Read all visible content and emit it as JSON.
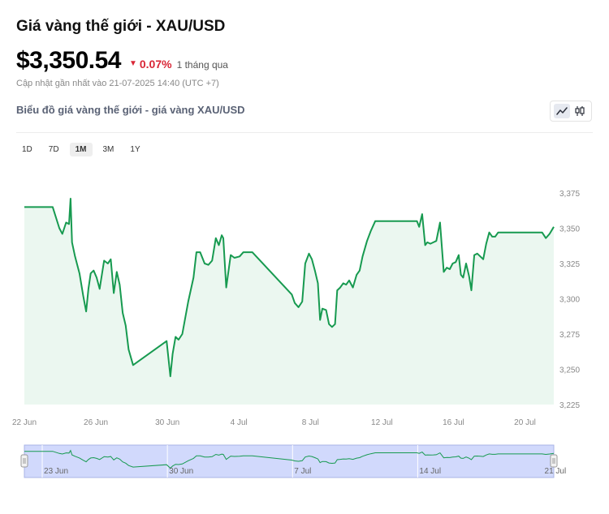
{
  "header": {
    "title": "Giá vàng thế giới - XAU/USD",
    "price": "$3,350.54",
    "change_arrow": "▼",
    "change_pct": "0.07%",
    "change_period": "1 tháng qua",
    "updated": "Cập nhật gần nhất vào 21-07-2025 14:40 (UTC +7)"
  },
  "chart_section": {
    "title": "Biểu đồ giá vàng thế giới - giá vàng XAU/USD"
  },
  "ranges": [
    "1D",
    "7D",
    "1M",
    "3M",
    "1Y"
  ],
  "active_range": "1M",
  "colors": {
    "line": "#179a50",
    "area": "#ebf7f0",
    "change": "#d92636",
    "navigator_fill": "#c9d2fb"
  },
  "icons": {
    "line_mode": "line-chart-icon",
    "candle_mode": "candlestick-icon"
  },
  "chart_data": {
    "type": "area",
    "title": "",
    "xlabel": "",
    "ylabel": "",
    "ylim": [
      3225,
      3375
    ],
    "y_ticks": [
      3225,
      3250,
      3275,
      3300,
      3325,
      3350,
      3375
    ],
    "y_tick_labels": [
      "3,225",
      "3,250",
      "3,275",
      "3,300",
      "3,325",
      "3,350",
      "3,375"
    ],
    "x_range": [
      "2025-06-22",
      "2025-07-21"
    ],
    "x_ticks": [
      {
        "date": "2025-06-22",
        "label": "22 Jun"
      },
      {
        "date": "2025-06-26",
        "label": "26 Jun"
      },
      {
        "date": "2025-06-30",
        "label": "30 Jun"
      },
      {
        "date": "2025-07-04",
        "label": "4 Jul"
      },
      {
        "date": "2025-07-08",
        "label": "8 Jul"
      },
      {
        "date": "2025-07-12",
        "label": "12 Jul"
      },
      {
        "date": "2025-07-16",
        "label": "16 Jul"
      },
      {
        "date": "2025-07-20",
        "label": "20 Jul"
      }
    ],
    "navigator_ticks": [
      {
        "date": "2025-06-23",
        "label": "23 Jun"
      },
      {
        "date": "2025-06-30",
        "label": "30 Jun"
      },
      {
        "date": "2025-07-07",
        "label": "7 Jul"
      },
      {
        "date": "2025-07-14",
        "label": "14 Jul"
      },
      {
        "date": "2025-07-21",
        "label": "21 Jul"
      }
    ],
    "series": [
      {
        "x": [
          "2025-06-22 00:00",
          "2025-06-23 14:00",
          "2025-06-23 23:00",
          "2025-06-24 03:00",
          "2025-06-24 08:00",
          "2025-06-24 12:00",
          "2025-06-24 14:00",
          "2025-06-24 16:00",
          "2025-06-24 20:00",
          "2025-06-25 02:00",
          "2025-06-25 07:00",
          "2025-06-25 11:00",
          "2025-06-25 14:00",
          "2025-06-25 17:00",
          "2025-06-25 21:00",
          "2025-06-26 01:00",
          "2025-06-26 05:00",
          "2025-06-26 11:00",
          "2025-06-26 16:00",
          "2025-06-26 20:00",
          "2025-06-27 00:00",
          "2025-06-27 04:00",
          "2025-06-27 08:00",
          "2025-06-27 12:00",
          "2025-06-27 16:00",
          "2025-06-27 20:00",
          "2025-06-28 02:00",
          "2025-06-29 23:00",
          "2025-06-30 04:00",
          "2025-06-30 07:00",
          "2025-06-30 11:00",
          "2025-06-30 15:00",
          "2025-06-30 20:00",
          "2025-07-01 04:00",
          "2025-07-01 11:00",
          "2025-07-01 15:00",
          "2025-07-01 20:00",
          "2025-07-02 02:00",
          "2025-07-02 07:00",
          "2025-07-02 12:00",
          "2025-07-02 17:00",
          "2025-07-02 21:00",
          "2025-07-03 01:00",
          "2025-07-03 03:00",
          "2025-07-03 07:00",
          "2025-07-03 13:00",
          "2025-07-03 18:00",
          "2025-07-04 01:00",
          "2025-07-04 06:00",
          "2025-07-04 13:00",
          "2025-07-04 18:00",
          "2025-07-06 23:00",
          "2025-07-07 03:00",
          "2025-07-07 08:00",
          "2025-07-07 13:00",
          "2025-07-07 17:00",
          "2025-07-07 22:00",
          "2025-07-08 02:00",
          "2025-07-08 06:00",
          "2025-07-08 10:00",
          "2025-07-08 13:00",
          "2025-07-08 16:00",
          "2025-07-08 21:00",
          "2025-07-09 01:00",
          "2025-07-09 05:00",
          "2025-07-09 09:00",
          "2025-07-09 12:00",
          "2025-07-09 16:00",
          "2025-07-09 20:00",
          "2025-07-10 00:00",
          "2025-07-10 04:00",
          "2025-07-10 09:00",
          "2025-07-10 14:00",
          "2025-07-10 18:00",
          "2025-07-10 22:00",
          "2025-07-11 04:00",
          "2025-07-11 09:00",
          "2025-07-11 15:00",
          "2025-07-11 21:00",
          "2025-07-13 23:00",
          "2025-07-14 02:00",
          "2025-07-14 06:00",
          "2025-07-14 10:00",
          "2025-07-14 13:00",
          "2025-07-14 17:00",
          "2025-07-14 21:00",
          "2025-07-15 01:00",
          "2025-07-15 06:00",
          "2025-07-15 11:00",
          "2025-07-15 15:00",
          "2025-07-15 19:00",
          "2025-07-15 23:00",
          "2025-07-16 03:00",
          "2025-07-16 07:00",
          "2025-07-16 10:00",
          "2025-07-16 13:00",
          "2025-07-16 17:00",
          "2025-07-16 21:00",
          "2025-07-17 00:00",
          "2025-07-17 04:00",
          "2025-07-17 08:00",
          "2025-07-17 12:00",
          "2025-07-17 16:00",
          "2025-07-17 20:00",
          "2025-07-18 00:00",
          "2025-07-18 04:00",
          "2025-07-18 08:00",
          "2025-07-18 12:00",
          "2025-07-18 18:00",
          "2025-07-20 23:00",
          "2025-07-21 04:00",
          "2025-07-21 09:00",
          "2025-07-21 14:40"
        ],
        "y": [
          3365,
          3365,
          3350,
          3346,
          3354,
          3353,
          3371,
          3340,
          3330,
          3318,
          3302,
          3291,
          3307,
          3318,
          3320,
          3315,
          3307,
          3327,
          3325,
          3328,
          3304,
          3319,
          3310,
          3290,
          3281,
          3264,
          3253,
          3270,
          3245,
          3261,
          3273,
          3271,
          3275,
          3298,
          3315,
          3333,
          3333,
          3325,
          3324,
          3327,
          3343,
          3338,
          3345,
          3343,
          3308,
          3331,
          3329,
          3330,
          3333,
          3333,
          3333,
          3303,
          3297,
          3294,
          3298,
          3325,
          3332,
          3328,
          3320,
          3311,
          3285,
          3293,
          3292,
          3282,
          3280,
          3282,
          3306,
          3308,
          3311,
          3310,
          3313,
          3308,
          3317,
          3320,
          3330,
          3341,
          3348,
          3355,
          3355,
          3355,
          3351,
          3360,
          3338,
          3340,
          3339,
          3340,
          3341,
          3354,
          3319,
          3322,
          3321,
          3325,
          3326,
          3331,
          3317,
          3315,
          3325,
          3316,
          3306,
          3331,
          3332,
          3330,
          3328,
          3339,
          3347,
          3344,
          3344,
          3347,
          3347,
          3347,
          3343,
          3346,
          3351
        ]
      }
    ]
  }
}
